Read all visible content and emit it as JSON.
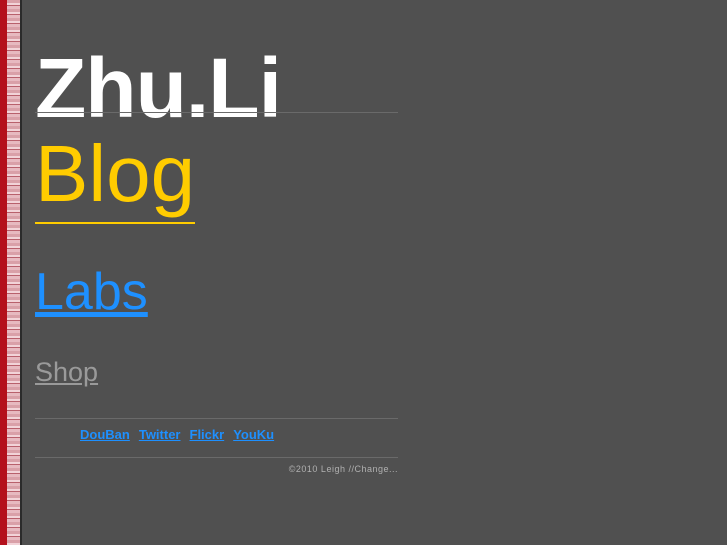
{
  "site": {
    "title": "Zhu.Li"
  },
  "nav": {
    "blog": "Blog",
    "labs": "Labs",
    "shop": "Shop"
  },
  "social": {
    "links": [
      "DouBan",
      "Twitter",
      "Flickr",
      "YouKu"
    ]
  },
  "footer": {
    "copyright": "©2010 Leigh //Change..."
  },
  "colors": {
    "background": "#505050",
    "title": "#ffffff",
    "blog": "#ffcc00",
    "link": "#1e90ff",
    "muted_link": "#9a9a9a",
    "strip_red": "#b4101c"
  }
}
